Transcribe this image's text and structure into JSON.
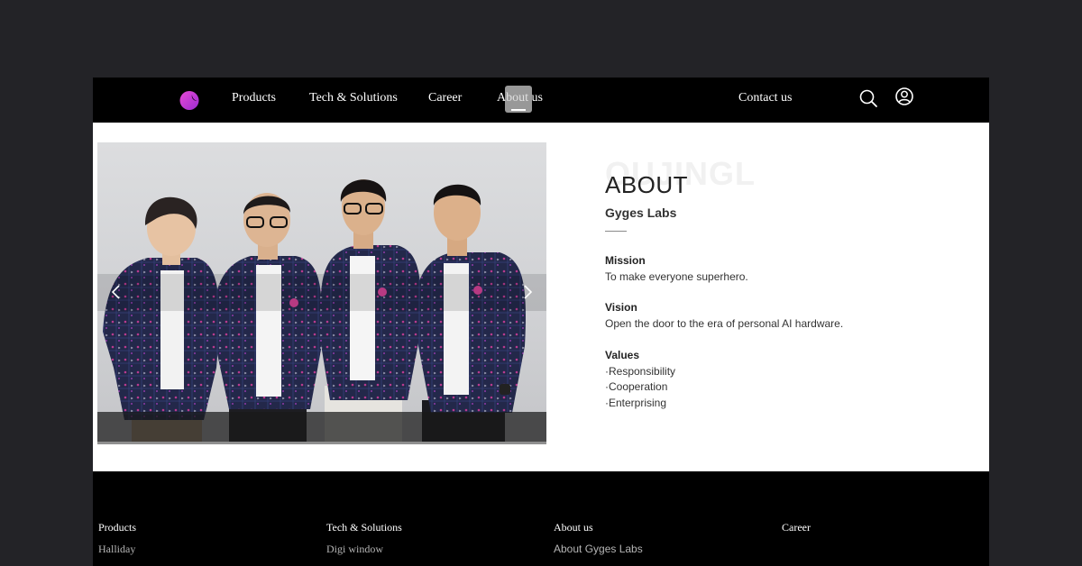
{
  "colors": {
    "page_bg": "#232327",
    "header_bg": "#000000",
    "footer_bg": "#000000",
    "accent_logo": "#c436d8"
  },
  "header": {
    "logo_icon": "brand-logo-icon",
    "nav": [
      {
        "label": "Products"
      },
      {
        "label": "Tech & Solutions"
      },
      {
        "label": "Career"
      },
      {
        "label": "About us"
      }
    ],
    "contact": "Contact us",
    "icons": [
      "search-icon",
      "user-icon"
    ]
  },
  "hero": {
    "carousel_icons": [
      "chevron-left-icon",
      "chevron-right-icon"
    ]
  },
  "about": {
    "watermark": "OUJINGL",
    "title": "ABOUT",
    "company": "Gyges Labs",
    "mission": {
      "heading": "Mission",
      "text": "To make everyone superhero."
    },
    "vision": {
      "heading": "Vision",
      "text": "Open the door to the era of personal AI hardware."
    },
    "values": {
      "heading": "Values",
      "items": [
        "·Responsibility",
        "·Cooperation",
        "·Enterprising"
      ]
    }
  },
  "footer": {
    "columns": [
      {
        "heading": "Products",
        "item": "Halliday"
      },
      {
        "heading": "Tech & Solutions",
        "item": "Digi window"
      },
      {
        "heading": "About us",
        "item": "About Gyges Labs"
      },
      {
        "heading": "Career",
        "item": ""
      }
    ]
  }
}
